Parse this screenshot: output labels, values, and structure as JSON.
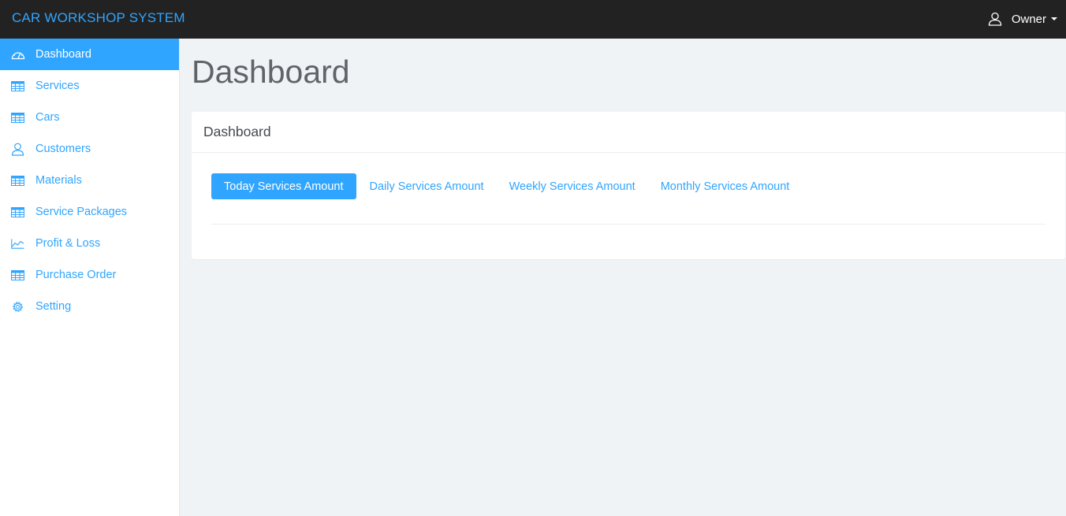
{
  "app": {
    "brand": "CAR WORKSHOP SYSTEM",
    "user_name": "Owner"
  },
  "sidebar": {
    "items": [
      {
        "label": "Dashboard",
        "icon": "dashboard-icon",
        "active": true
      },
      {
        "label": "Services",
        "icon": "table-icon"
      },
      {
        "label": "Cars",
        "icon": "table-icon"
      },
      {
        "label": "Customers",
        "icon": "user-icon"
      },
      {
        "label": "Materials",
        "icon": "table-icon"
      },
      {
        "label": "Service Packages",
        "icon": "table-icon"
      },
      {
        "label": "Profit & Loss",
        "icon": "line-chart-icon"
      },
      {
        "label": "Purchase Order",
        "icon": "table-icon"
      },
      {
        "label": "Setting",
        "icon": "gear-icon"
      }
    ]
  },
  "main": {
    "title": "Dashboard",
    "panel": {
      "heading": "Dashboard",
      "tabs": [
        {
          "label": "Today Services Amount",
          "active": true
        },
        {
          "label": "Daily Services Amount"
        },
        {
          "label": "Weekly Services Amount"
        },
        {
          "label": "Monthly Services Amount"
        }
      ]
    }
  },
  "colors": {
    "accent": "#30a5ff",
    "topbar": "#222222",
    "background": "#f0f3f5"
  }
}
